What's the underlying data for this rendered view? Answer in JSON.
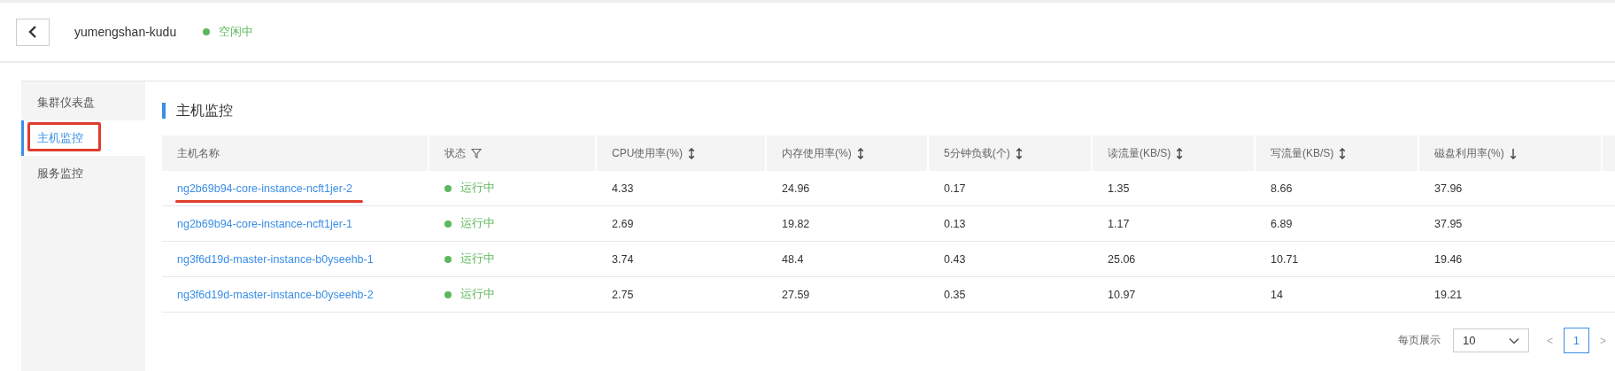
{
  "header": {
    "cluster_name": "yumengshan-kudu",
    "status": {
      "label": "空闲中",
      "color": "#5cb85c"
    }
  },
  "sidebar": {
    "items": [
      {
        "label": "集群仪表盘",
        "selected": false
      },
      {
        "label": "主机监控",
        "selected": true
      },
      {
        "label": "服务监控",
        "selected": false
      }
    ]
  },
  "section_title": "主机监控",
  "table": {
    "columns": [
      {
        "label": "主机名称"
      },
      {
        "label": "状态",
        "filter": true
      },
      {
        "label": "CPU使用率(%)",
        "sorted_descending": false
      },
      {
        "label": "内存使用率(%)",
        "sorted_descending": false
      },
      {
        "label": "5分钟负载(个)",
        "sorted_descending": false
      },
      {
        "label": "读流量(KB/S)",
        "sorted_descending": false
      },
      {
        "label": "写流量(KB/S)",
        "sorted_descending": false
      },
      {
        "label": "磁盘利用率(%)",
        "sorted_descending": true
      }
    ],
    "rows": [
      {
        "color": "#5cb85c",
        "cells": [
          "ng2b69b94-core-instance-ncft1jer-2",
          "运行中",
          "4.33",
          "24.96",
          "0.17",
          "1.35",
          "8.66",
          "37.96"
        ]
      },
      {
        "color": "#5cb85c",
        "cells": [
          "ng2b69b94-core-instance-ncft1jer-1",
          "运行中",
          "2.69",
          "19.82",
          "0.13",
          "1.17",
          "6.89",
          "37.95"
        ]
      },
      {
        "color": "#5cb85c",
        "cells": [
          "ng3f6d19d-master-instance-b0yseehb-1",
          "运行中",
          "3.74",
          "48.4",
          "0.43",
          "25.06",
          "10.71",
          "19.46"
        ]
      },
      {
        "color": "#5cb85c",
        "cells": [
          "ng3f6d19d-master-instance-b0yseehb-2",
          "运行中",
          "2.75",
          "27.59",
          "0.35",
          "10.97",
          "14",
          "19.21"
        ]
      }
    ]
  },
  "pagination": {
    "page_size_label": "每页展示",
    "page_size": "10",
    "prev": "<",
    "pages": [
      {
        "label": "1",
        "selected": true
      }
    ],
    "next": ">"
  }
}
